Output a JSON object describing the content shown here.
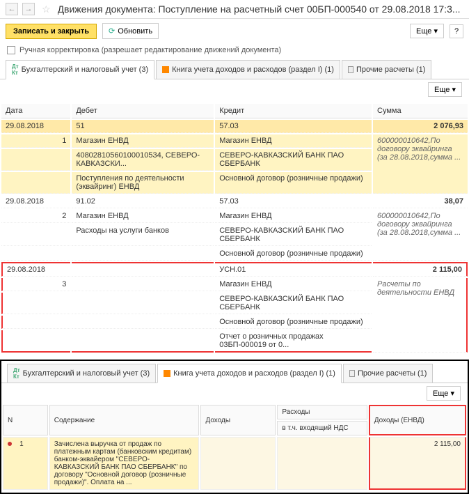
{
  "header": {
    "title": "Движения документа: Поступление на расчетный счет 00БП-000540 от 29.08.2018 17:3..."
  },
  "actions": {
    "save_close": "Записать и закрыть",
    "refresh": "Обновить",
    "more": "Еще",
    "help": "?"
  },
  "manual_edit": "Ручная корректировка (разрешает редактирование движений документа)",
  "tabs": [
    {
      "label": "Бухгалтерский и налоговый учет (3)"
    },
    {
      "label": "Книга учета доходов и расходов (раздел I) (1)"
    },
    {
      "label": "Прочие расчеты (1)"
    }
  ],
  "table1": {
    "headers": {
      "date": "Дата",
      "debit": "Дебет",
      "credit": "Кредит",
      "sum": "Сумма"
    },
    "rows": [
      {
        "date": "29.08.2018",
        "n": "1",
        "debit_acc": "51",
        "debit_l1": "Магазин ЕНВД",
        "debit_l2": "40802810560100010534, СЕВЕРО-КАВКАЗСКИ...",
        "debit_l3": "Поступления по деятельности (эквайринг) ЕНВД",
        "credit_acc": "57.03",
        "credit_l1": "Магазин ЕНВД",
        "credit_l2": "СЕВЕРО-КАВКАЗСКИЙ БАНК ПАО СБЕРБАНК",
        "credit_l3": "Основной договор (розничные продажи)",
        "sum": "2 076,93",
        "sum_note": "600000010642,По договору эквайринга (за 28.08.2018,сумма ...",
        "hl": true
      },
      {
        "date": "29.08.2018",
        "n": "2",
        "debit_acc": "91.02",
        "debit_l1": "Магазин ЕНВД",
        "debit_l2": "Расходы на услуги банков",
        "debit_l3": "",
        "credit_acc": "57.03",
        "credit_l1": "Магазин ЕНВД",
        "credit_l2": "СЕВЕРО-КАВКАЗСКИЙ БАНК ПАО СБЕРБАНК",
        "credit_l3": "Основной договор (розничные продажи)",
        "sum": "38,07",
        "sum_note": "600000010642,По договору эквайринга (за 28.08.2018,сумма ...",
        "hl": false
      },
      {
        "date": "29.08.2018",
        "n": "3",
        "debit_acc": "",
        "debit_l1": "",
        "debit_l2": "",
        "debit_l3": "",
        "credit_acc": "УСН.01",
        "credit_l1": "Магазин ЕНВД",
        "credit_l2": "СЕВЕРО-КАВКАЗСКИЙ БАНК ПАО СБЕРБАНК",
        "credit_l3": "Основной договор (розничные продажи)",
        "credit_l4": "Отчет о розничных продажах 03БП-000019 от 0...",
        "sum": "2 115,00",
        "sum_note": "Расчеты по деятельности ЕНВД",
        "red": true
      }
    ]
  },
  "table2": {
    "headers": {
      "n": "N",
      "cont": "Содержание",
      "income": "Доходы",
      "expense": "Расходы",
      "vat": "в т.ч. входящий НДС",
      "income_envd": "Доходы (ЕНВД)"
    },
    "rows": [
      {
        "n": "1",
        "cont": "Зачислена выручка от продаж по платежным картам (банковским кредитам) банком-эквайером \"СЕВЕРО-КАВКАЗСКИЙ БАНК ПАО СБЕРБАНК\" по договору \"Основной договор (розничные продажи)\". Оплата на ...",
        "income": "",
        "expense": "",
        "income_envd": "2 115,00"
      }
    ]
  }
}
